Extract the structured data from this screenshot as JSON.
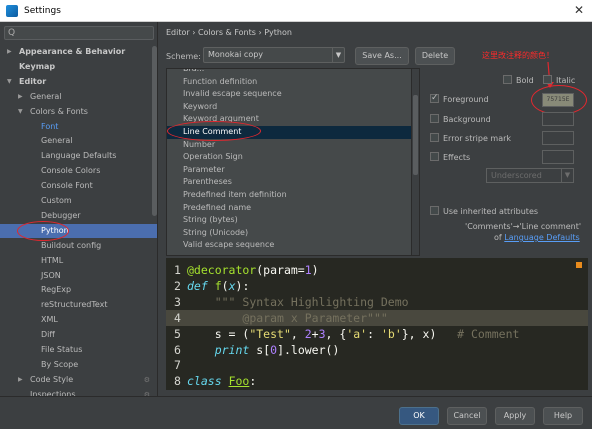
{
  "window": {
    "title": "Settings",
    "close_glyph": "✕"
  },
  "search": {
    "icon": "search-icon",
    "glyph": "Q"
  },
  "tree": [
    {
      "label": "Appearance & Behavior",
      "indent": 0,
      "arrow": "right",
      "bold": true
    },
    {
      "label": "Keymap",
      "indent": 0,
      "arrow": "",
      "bold": true
    },
    {
      "label": "Editor",
      "indent": 0,
      "arrow": "down",
      "bold": true
    },
    {
      "label": "General",
      "indent": 1,
      "arrow": "right",
      "bold": false
    },
    {
      "label": "Colors & Fonts",
      "indent": 1,
      "arrow": "down",
      "bold": false
    },
    {
      "label": "Font",
      "indent": 2,
      "arrow": "",
      "bold": false
    },
    {
      "label": "General",
      "indent": 2,
      "arrow": "",
      "bold": false
    },
    {
      "label": "Language Defaults",
      "indent": 2,
      "arrow": "",
      "bold": false
    },
    {
      "label": "Console Colors",
      "indent": 2,
      "arrow": "",
      "bold": false
    },
    {
      "label": "Console Font",
      "indent": 2,
      "arrow": "",
      "bold": false
    },
    {
      "label": "Custom",
      "indent": 2,
      "arrow": "",
      "bold": false
    },
    {
      "label": "Debugger",
      "indent": 2,
      "arrow": "",
      "bold": false
    },
    {
      "label": "Python",
      "indent": 2,
      "arrow": "",
      "bold": false,
      "selected": true
    },
    {
      "label": "Buildout config",
      "indent": 2,
      "arrow": "",
      "bold": false
    },
    {
      "label": "HTML",
      "indent": 2,
      "arrow": "",
      "bold": false
    },
    {
      "label": "JSON",
      "indent": 2,
      "arrow": "",
      "bold": false
    },
    {
      "label": "RegExp",
      "indent": 2,
      "arrow": "",
      "bold": false
    },
    {
      "label": "reStructuredText",
      "indent": 2,
      "arrow": "",
      "bold": false
    },
    {
      "label": "XML",
      "indent": 2,
      "arrow": "",
      "bold": false
    },
    {
      "label": "Diff",
      "indent": 2,
      "arrow": "",
      "bold": false
    },
    {
      "label": "File Status",
      "indent": 2,
      "arrow": "",
      "bold": false
    },
    {
      "label": "By Scope",
      "indent": 2,
      "arrow": "",
      "bold": false
    },
    {
      "label": "Code Style",
      "indent": 1,
      "arrow": "right",
      "bold": false,
      "gear": true
    },
    {
      "label": "Inspections",
      "indent": 1,
      "arrow": "",
      "bold": false,
      "gear": true
    }
  ],
  "breadcrumb": "Editor › Colors & Fonts › Python",
  "scheme": {
    "label": "Scheme:",
    "value": "Monokai copy",
    "save_as": "Save As...",
    "delete": "Delete"
  },
  "attributes": [
    "Bra...",
    "Function definition",
    "Invalid escape sequence",
    "Keyword",
    "Keyword argument",
    "Line Comment",
    "Number",
    "Operation Sign",
    "Parameter",
    "Parentheses",
    "Predefined item definition",
    "Predefined name",
    "String (bytes)",
    "String (Unicode)",
    "Valid escape sequence"
  ],
  "selected_attribute": "Line Comment",
  "annotation": {
    "text": "这里改注释的颜色！",
    "color": "#ff2a2a"
  },
  "options": {
    "bold": "Bold",
    "italic": "Italic",
    "foreground": "Foreground",
    "foreground_value": "75715E",
    "background": "Background",
    "error_stripe": "Error stripe mark",
    "effects": "Effects",
    "effects_value": "Underscored",
    "inherit": "Use inherited attributes",
    "inherit_note": "'Comments'→'Line comment'",
    "inherit_of": "of ",
    "inherit_link": "Language Defaults"
  },
  "editor_lines": [
    {
      "n": "1",
      "html": "<span class='c-dec'>@decorator</span><span class='c-id'>(param=</span><span class='c-num'>1</span><span class='c-id'>)</span>"
    },
    {
      "n": "2",
      "html": "<span class='c-kw'>def</span> <span class='c-fn'>f</span><span class='c-id'>(</span><span class='c-kw'>x</span><span class='c-id'>):</span>"
    },
    {
      "n": "3",
      "html": "    <span class='c-doc'>\"\"\" Syntax Highlighting Demo</span>"
    },
    {
      "n": "4",
      "html": "        <span class='c-doc'>@param x Parameter\"\"\"</span>",
      "hl": true
    },
    {
      "n": "5",
      "html": "    <span class='c-id'>s = (</span><span class='c-str'>\"Test\"</span><span class='c-id'>, </span><span class='c-num'>2</span><span class='c-id'>+</span><span class='c-num'>3</span><span class='c-id'>, {</span><span class='c-str'>'a'</span><span class='c-id'>: </span><span class='c-str'>'b'</span><span class='c-id'>}, x)   </span><span class='c-cmt'># Comment</span>"
    },
    {
      "n": "6",
      "html": "    <span class='c-kw'>print</span> <span class='c-id'>s[</span><span class='c-num'>0</span><span class='c-id'>].lower()</span>"
    },
    {
      "n": "7",
      "html": ""
    },
    {
      "n": "8",
      "html": "<span class='c-kw'>class</span> <span class='c-cls'>Foo</span><span class='c-id'>:</span>"
    }
  ],
  "footer": {
    "ok": "OK",
    "cancel": "Cancel",
    "apply": "Apply",
    "help": "Help"
  },
  "colors": {
    "selection": "#4b6eaf",
    "annotation": "#e0282f",
    "editor_bg": "#272822"
  }
}
